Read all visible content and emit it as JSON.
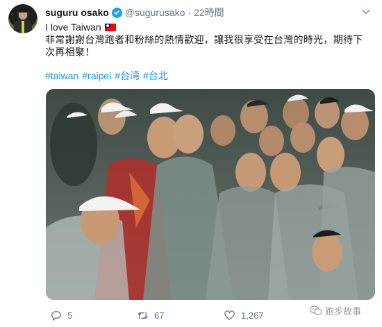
{
  "tweet": {
    "display_name": "suguru osako",
    "handle": "@sugurusako",
    "separator": "·",
    "time": "22時間",
    "text_line1": "I love Taiwan",
    "text_line2": "非常謝謝台灣跑者和粉絲的熱情歡迎，讓我很享受在台灣的時光，期待下次再相聚！",
    "hashtags": [
      "#taiwan",
      "#raipei",
      "#台湾",
      "#台北"
    ]
  },
  "actions": {
    "reply_count": "5",
    "retweet_count": "67",
    "like_count": "1,267"
  },
  "watermark": {
    "text": "跑步故事"
  },
  "colors": {
    "link": "#1b95e0",
    "verified": "#1da1f2",
    "muted": "#657786"
  }
}
